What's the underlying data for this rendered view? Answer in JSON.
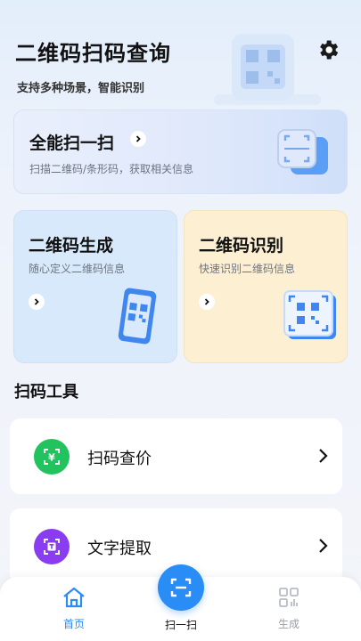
{
  "header": {
    "title": "二维码扫码查询",
    "subtitle": "支持多种场景，智能识别",
    "settings_icon": "gear-icon"
  },
  "cards": {
    "scan": {
      "title": "全能扫一扫",
      "subtitle": "扫描二维码/条形码，获取相关信息"
    },
    "generate": {
      "title": "二维码生成",
      "subtitle": "随心定义二维码信息"
    },
    "recognize": {
      "title": "二维码识别",
      "subtitle": "快速识别二维码信息"
    }
  },
  "tools": {
    "section_title": "扫码工具",
    "items": [
      {
        "label": "扫码查价",
        "icon": "yen-scan-icon",
        "color": "#22c35e"
      },
      {
        "label": "文字提取",
        "icon": "text-scan-icon",
        "color": "#8a3cf0"
      }
    ]
  },
  "nav": {
    "home": "首页",
    "scan": "扫一扫",
    "generate": "生成"
  },
  "colors": {
    "accent": "#2a8df5",
    "green": "#22c35e",
    "purple": "#8a3cf0"
  }
}
